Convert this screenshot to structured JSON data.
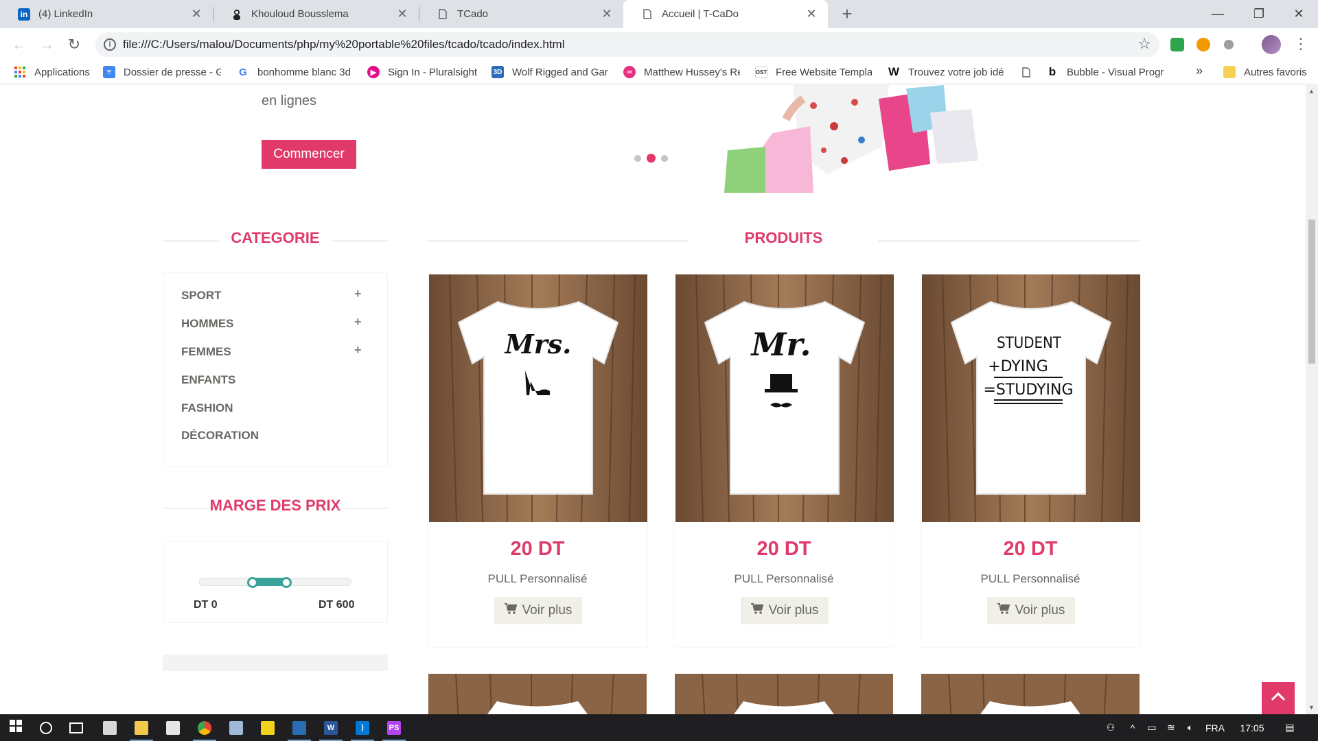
{
  "browser": {
    "tabs": [
      {
        "title": "(4) LinkedIn",
        "icon": "linkedin-icon"
      },
      {
        "title": "Khouloud Bousslema",
        "icon": "person-icon"
      },
      {
        "title": "TCado",
        "icon": "page-icon"
      },
      {
        "title": "Accueil | T-CaDo",
        "icon": "page-icon",
        "active": true
      }
    ],
    "url": "file:///C:/Users/malou/Documents/php/my%20portable%20files/tcado/tcado/index.html",
    "bookmarks": [
      {
        "label": "Applications",
        "icon": "apps-grid-icon"
      },
      {
        "label": "Dossier de presse - G",
        "icon": "docs-icon"
      },
      {
        "label": "bonhomme blanc 3d",
        "icon": "google-icon"
      },
      {
        "label": "Sign In - Pluralsight",
        "icon": "pluralsight-icon"
      },
      {
        "label": "Wolf Rigged and Gan",
        "icon": "3d-icon"
      },
      {
        "label": "Matthew Hussey's Re",
        "icon": "mh-icon"
      },
      {
        "label": "Free Website Templat",
        "icon": "ost-icon"
      },
      {
        "label": "Trouvez votre job idé",
        "icon": "w-icon"
      },
      {
        "label": "",
        "icon": "page-icon"
      },
      {
        "label": "Bubble - Visual Progr",
        "icon": "bubble-icon"
      }
    ],
    "bookmarks_more": "»",
    "other_bookmarks": "Autres favoris"
  },
  "hero": {
    "text": "en lignes",
    "button": "Commencer",
    "carousel_active_index": 1
  },
  "sidebar": {
    "category_title": "CATEGORIE",
    "categories": [
      {
        "label": "SPORT",
        "expandable": true
      },
      {
        "label": "HOMMES",
        "expandable": true
      },
      {
        "label": "FEMMES",
        "expandable": true
      },
      {
        "label": "ENFANTS",
        "expandable": false
      },
      {
        "label": "FASHION",
        "expandable": false
      },
      {
        "label": "DÉCORATION",
        "expandable": false
      }
    ],
    "expand_symbol": "+",
    "price_title": "MARGE DES PRIX",
    "price_min_label": "DT 0",
    "price_max_label": "DT 600",
    "price_range_selected": [
      0.35,
      0.57
    ]
  },
  "products": {
    "title": "PRODUITS",
    "items": [
      {
        "price": "20 DT",
        "name": "PULL Personnalisé",
        "button": "Voir plus",
        "print": "Mrs."
      },
      {
        "price": "20 DT",
        "name": "PULL Personnalisé",
        "button": "Voir plus",
        "print": "Mr."
      },
      {
        "price": "20 DT",
        "name": "PULL Personnalisé",
        "button": "Voir plus",
        "print_lines": [
          "STUDENT",
          "+DYING",
          "=STUDYING"
        ]
      }
    ]
  },
  "taskbar": {
    "language": "FRA",
    "time": "17:05"
  },
  "colors": {
    "accent": "#e13a6a",
    "slider": "#3ba39a",
    "button_bg": "#f0f0e9",
    "text_muted": "#696763"
  }
}
